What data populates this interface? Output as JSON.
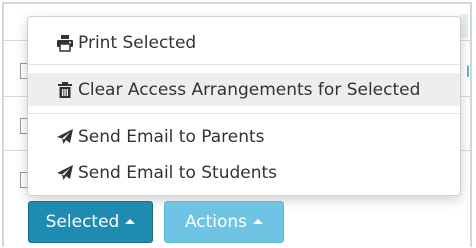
{
  "menu": {
    "items": [
      {
        "label": "Print Selected",
        "icon": "printer-icon"
      },
      {
        "label": "Clear Access Arrangements for Selected",
        "icon": "trash-icon",
        "highlighted": true
      },
      {
        "label": "Send Email to Parents",
        "icon": "paper-plane-icon"
      },
      {
        "label": "Send Email to Students",
        "icon": "paper-plane-icon"
      }
    ]
  },
  "buttons": {
    "selected_label": "Selected",
    "actions_label": "Actions"
  },
  "table": {
    "edge_text": "l"
  },
  "colors": {
    "primary": "#1f8bb0",
    "primary_light": "#6ec4e2",
    "menu_hover": "#eeeeee",
    "text": "#333333"
  }
}
